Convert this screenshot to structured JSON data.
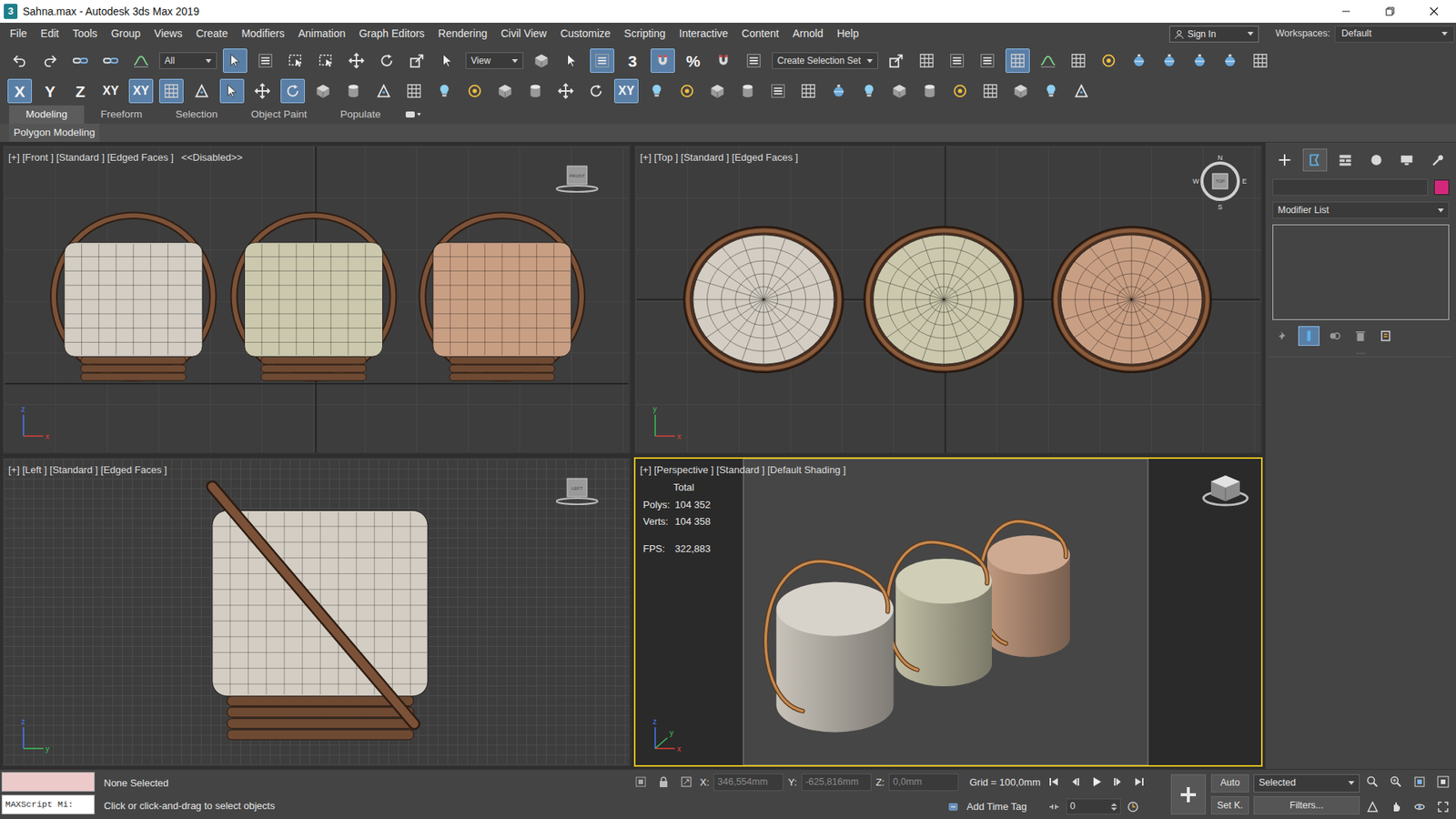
{
  "window": {
    "app_icon": "3",
    "title": "Sahna.max - Autodesk 3ds Max 2019"
  },
  "menu": [
    "File",
    "Edit",
    "Tools",
    "Group",
    "Views",
    "Create",
    "Modifiers",
    "Animation",
    "Graph Editors",
    "Rendering",
    "Civil View",
    "Customize",
    "Scripting",
    "Interactive",
    "Content",
    "Arnold",
    "Help"
  ],
  "account": {
    "sign_in": "Sign In",
    "workspaces_label": "Workspaces:",
    "workspace": "Default"
  },
  "main_toolbar": [
    {
      "kind": "icon",
      "selected": false
    },
    {
      "kind": "icon",
      "selected": false
    },
    {
      "kind": "icon",
      "selected": false
    },
    {
      "kind": "icon",
      "selected": false
    },
    {
      "kind": "icon",
      "selected": false
    },
    {
      "kind": "dropdown",
      "label": "All"
    },
    {
      "kind": "icon",
      "selected": true
    },
    {
      "kind": "icon",
      "selected": false
    },
    {
      "kind": "icon",
      "selected": false
    },
    {
      "kind": "icon",
      "selected": false
    },
    {
      "kind": "icon",
      "selected": false
    },
    {
      "kind": "icon",
      "selected": false
    },
    {
      "kind": "icon",
      "selected": false
    },
    {
      "kind": "icon",
      "selected": false
    },
    {
      "kind": "dropdown",
      "label": "View"
    },
    {
      "kind": "icon",
      "selected": false
    },
    {
      "kind": "icon",
      "selected": false
    },
    {
      "kind": "icon",
      "selected": true
    },
    {
      "kind": "glyph",
      "label": "3",
      "selected": false
    },
    {
      "kind": "icon",
      "selected": true
    },
    {
      "kind": "glyph",
      "label": "%",
      "selected": false
    },
    {
      "kind": "icon",
      "selected": false
    },
    {
      "kind": "icon",
      "selected": false
    },
    {
      "kind": "dropdown",
      "label": "Create Selection Set"
    },
    {
      "kind": "icon",
      "selected": false
    },
    {
      "kind": "icon",
      "selected": false
    },
    {
      "kind": "icon",
      "selected": false
    },
    {
      "kind": "icon",
      "selected": false
    },
    {
      "kind": "icon",
      "selected": true
    },
    {
      "kind": "icon",
      "selected": false
    },
    {
      "kind": "icon",
      "selected": false
    },
    {
      "kind": "icon",
      "selected": false
    },
    {
      "kind": "icon",
      "selected": false
    },
    {
      "kind": "icon",
      "selected": false
    },
    {
      "kind": "icon",
      "selected": false
    },
    {
      "kind": "icon",
      "selected": false
    },
    {
      "kind": "icon",
      "selected": false
    }
  ],
  "axis_toolbar": [
    {
      "kind": "glyph",
      "label": "X",
      "selected": true
    },
    {
      "kind": "glyph",
      "label": "Y",
      "selected": false
    },
    {
      "kind": "glyph",
      "label": "Z",
      "selected": false
    },
    {
      "kind": "glyph",
      "label": "XY",
      "selected": false
    },
    {
      "kind": "glyph",
      "label": "XY",
      "selected": true
    },
    {
      "kind": "icon",
      "selected": true
    },
    {
      "kind": "icon",
      "selected": false
    },
    {
      "kind": "icon",
      "selected": true
    },
    {
      "kind": "icon",
      "selected": false
    },
    {
      "kind": "icon",
      "selected": true
    },
    {
      "kind": "icon",
      "selected": false
    },
    {
      "kind": "icon",
      "selected": false
    },
    {
      "kind": "icon",
      "selected": false
    },
    {
      "kind": "icon",
      "selected": false
    },
    {
      "kind": "icon",
      "selected": false
    },
    {
      "kind": "icon",
      "selected": false
    },
    {
      "kind": "icon",
      "selected": false
    },
    {
      "kind": "icon",
      "selected": false
    },
    {
      "kind": "icon",
      "selected": false
    },
    {
      "kind": "icon",
      "selected": false
    },
    {
      "kind": "glyph",
      "label": "XY",
      "selected": true
    },
    {
      "kind": "icon",
      "selected": false
    },
    {
      "kind": "icon",
      "selected": false
    },
    {
      "kind": "icon",
      "selected": false
    },
    {
      "kind": "icon",
      "selected": false
    },
    {
      "kind": "icon",
      "selected": false
    },
    {
      "kind": "icon",
      "selected": false
    },
    {
      "kind": "icon",
      "selected": false
    },
    {
      "kind": "icon",
      "selected": false
    },
    {
      "kind": "icon",
      "selected": false
    },
    {
      "kind": "icon",
      "selected": false
    },
    {
      "kind": "icon",
      "selected": false
    },
    {
      "kind": "icon",
      "selected": false
    },
    {
      "kind": "icon",
      "selected": false
    },
    {
      "kind": "icon",
      "selected": false
    },
    {
      "kind": "icon",
      "selected": false
    }
  ],
  "ribbon": {
    "tabs": [
      {
        "label": "Modeling",
        "selected": true
      },
      {
        "label": "Freeform",
        "selected": false
      },
      {
        "label": "Selection",
        "selected": false
      },
      {
        "label": "Object Paint",
        "selected": false
      },
      {
        "label": "Populate",
        "selected": false
      }
    ],
    "panel": "Polygon Modeling"
  },
  "viewports": [
    {
      "view": "front",
      "label": "[+] [Front ] [Standard ] [Edged Faces ]",
      "note": "<<Disabled>>",
      "cube": "FRONT",
      "active": false,
      "axes": [
        "x",
        "z"
      ]
    },
    {
      "view": "top",
      "label": "[+] [Top ] [Standard ] [Edged Faces ]",
      "cube": "TOP",
      "compass": [
        "N",
        "E",
        "S",
        "W"
      ],
      "active": false,
      "axes": [
        "x",
        "y"
      ]
    },
    {
      "view": "left",
      "label": "[+] [Left ] [Standard ] [Edged Faces ]",
      "cube": "LEFT",
      "active": false,
      "axes": [
        "y",
        "z"
      ]
    },
    {
      "view": "perspective",
      "label": "[+] [Perspective ] [Standard ] [Default Shading ]",
      "active": true,
      "axes": [
        "x",
        "z",
        "y"
      ],
      "stats": {
        "title": "Total",
        "rows": [
          {
            "label": "Polys:",
            "value": "104 352"
          },
          {
            "label": "Verts:",
            "value": "104 358"
          },
          {
            "label": "FPS:",
            "value": "322,883"
          }
        ]
      }
    }
  ],
  "objects": [
    {
      "color": "#d3cdc3"
    },
    {
      "color": "#cbc8ad"
    },
    {
      "color": "#c99f84"
    }
  ],
  "command_panel": {
    "tabs": [
      {
        "selected": false
      },
      {
        "selected": true
      },
      {
        "selected": false
      },
      {
        "selected": false
      },
      {
        "selected": false
      },
      {
        "selected": false
      }
    ],
    "color": "#d4287c",
    "modifier_list": "Modifier List",
    "stack_buttons": [
      {
        "selected": false
      },
      {
        "selected": true
      },
      {
        "selected": false
      },
      {
        "selected": false
      },
      {
        "selected": false
      }
    ]
  },
  "status": {
    "maxscript": "MAXScript Mi:",
    "selection": "None Selected",
    "prompt": "Click or click-and-drag to select objects",
    "coords": [
      {
        "label": "X:",
        "value": "346,554mm",
        "disabled": true
      },
      {
        "label": "Y:",
        "value": "-625,816mm",
        "disabled": true
      },
      {
        "label": "Z:",
        "value": "0,0mm",
        "disabled": true
      }
    ],
    "grid": "Grid = 100,0mm",
    "time_tag": "Add Time Tag",
    "frame": "0",
    "auto": "Auto",
    "key_filter": "Selected",
    "set_key": "Set K.",
    "filters": "Filters..."
  }
}
